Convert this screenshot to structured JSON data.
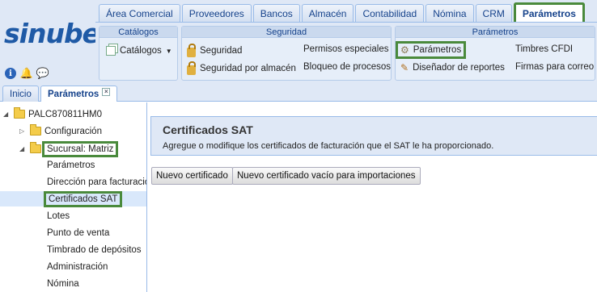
{
  "app": {
    "logo": "sinube"
  },
  "top_tabs": [
    {
      "label": "Área Comercial"
    },
    {
      "label": "Proveedores"
    },
    {
      "label": "Bancos"
    },
    {
      "label": "Almacén"
    },
    {
      "label": "Contabilidad"
    },
    {
      "label": "Nómina"
    },
    {
      "label": "CRM"
    },
    {
      "label": "Parámetros",
      "active": true
    }
  ],
  "ribbon": {
    "catalogos": {
      "title": "Catálogos",
      "item": "Catálogos"
    },
    "seguridad": {
      "title": "Seguridad",
      "items": [
        "Seguridad",
        "Seguridad por almacén",
        "Permisos especiales",
        "Bloqueo de procesos"
      ]
    },
    "parametros": {
      "title": "Parámetros",
      "items": [
        "Parámetros",
        "Diseñador de reportes",
        "Timbres CFDI",
        "Firmas para correo"
      ]
    }
  },
  "sub_tabs": [
    {
      "label": "Inicio"
    },
    {
      "label": "Parámetros",
      "active": true,
      "close": "×"
    }
  ],
  "tree": {
    "root": "PALC870811HM0",
    "nodes": [
      {
        "label": "Configuración",
        "type": "folder"
      },
      {
        "label": "Sucursal: Matriz",
        "type": "folder"
      },
      {
        "label": "Parámetros"
      },
      {
        "label": "Dirección para facturación"
      },
      {
        "label": "Certificados SAT",
        "selected": true
      },
      {
        "label": "Lotes"
      },
      {
        "label": "Punto de venta"
      },
      {
        "label": "Timbrado de depósitos"
      },
      {
        "label": "Administración"
      },
      {
        "label": "Nómina"
      }
    ]
  },
  "panel": {
    "title": "Certificados SAT",
    "description": "Agregue o modifique los certificados de facturación que el SAT le ha proporcionado."
  },
  "buttons": {
    "new_cert": "Nuevo certificado",
    "new_empty_cert": "Nuevo certificado vacío para importaciones"
  },
  "colors": {
    "highlight": "#4a8a3c",
    "accent": "#15428b",
    "header_bg": "#dfe8f6"
  }
}
